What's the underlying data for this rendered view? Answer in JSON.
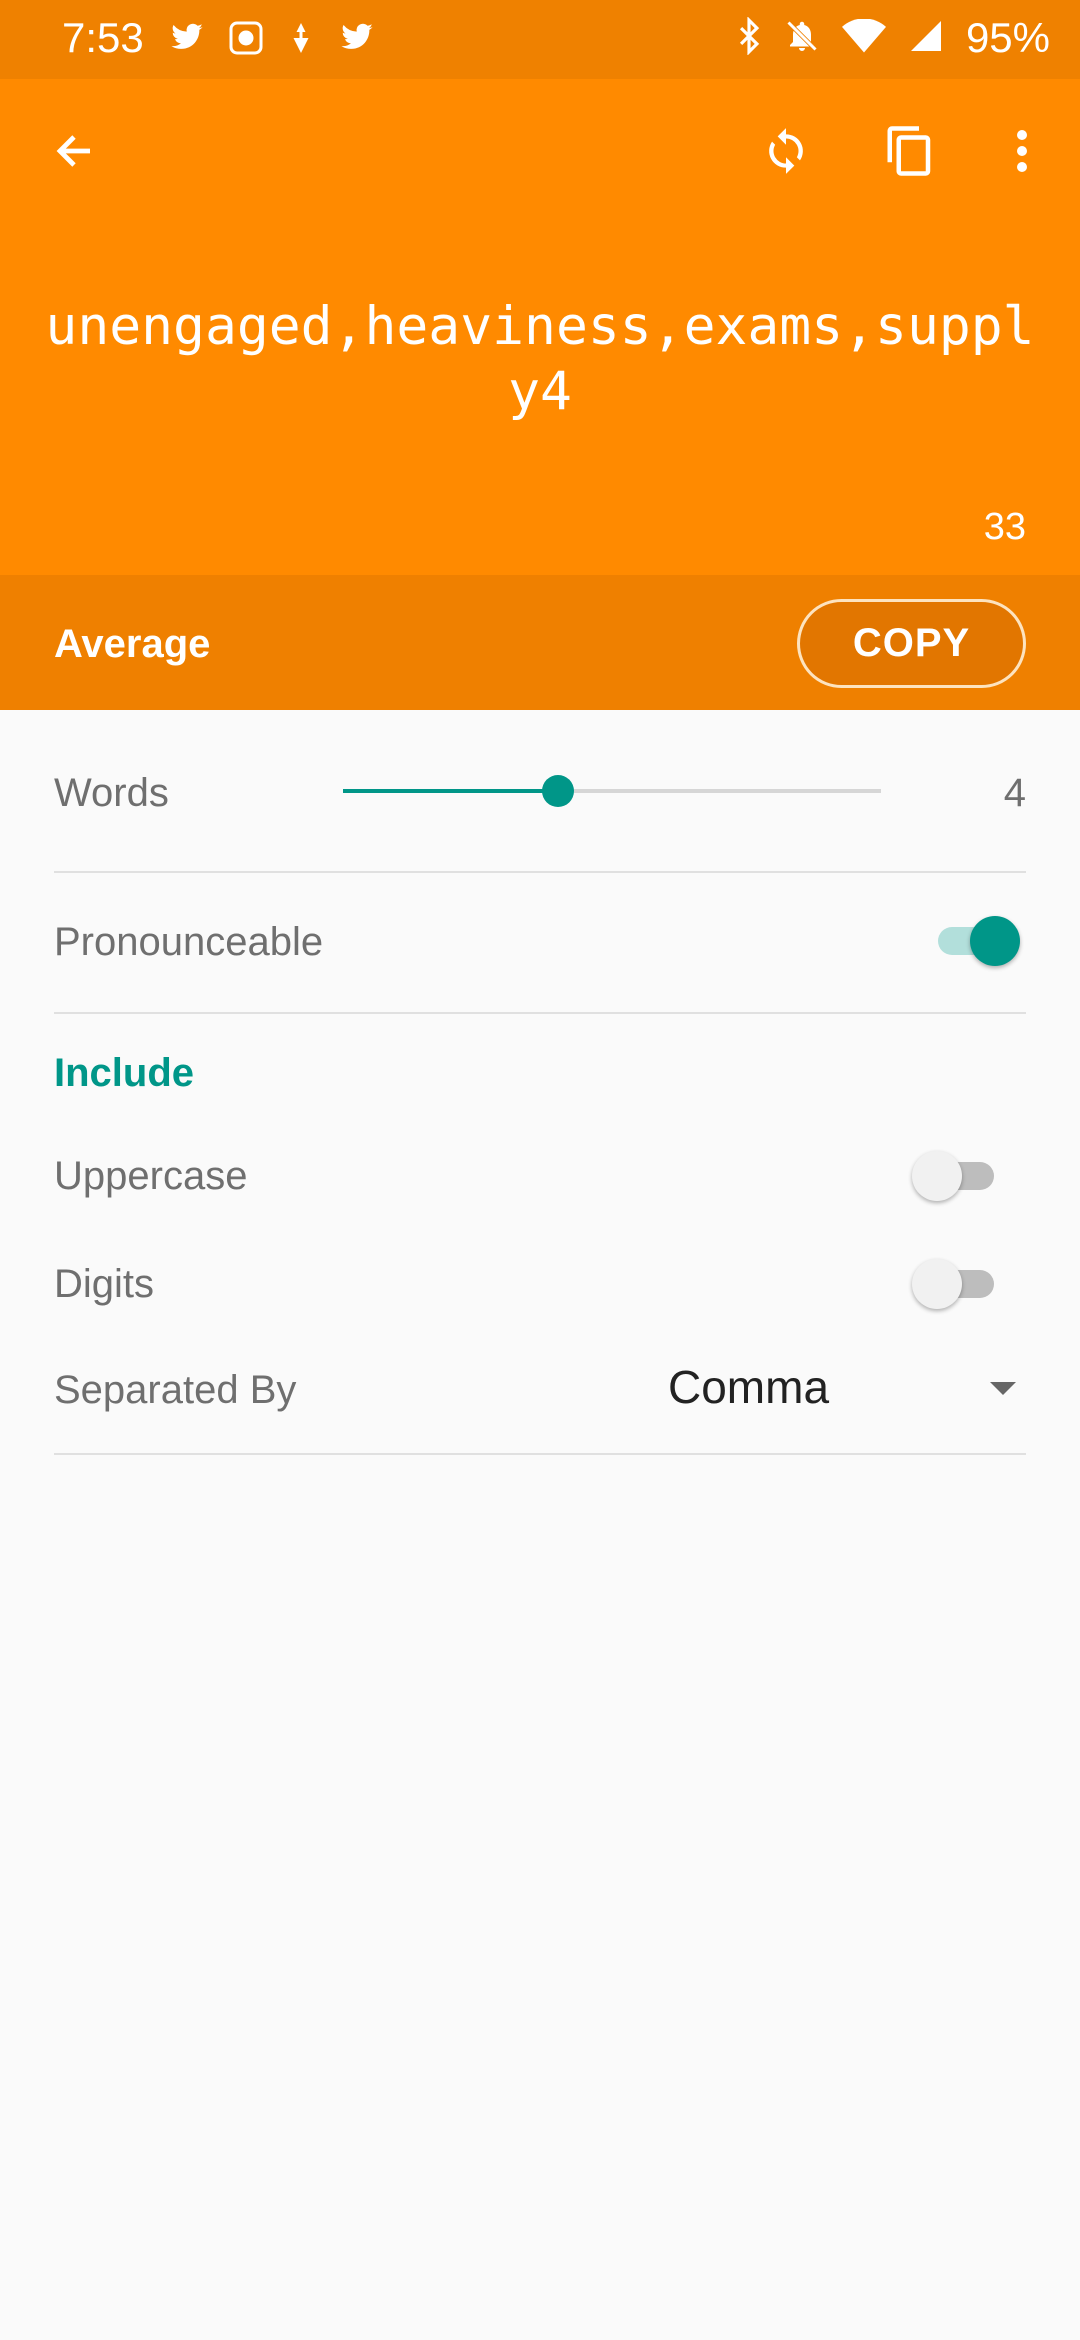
{
  "status_bar": {
    "time": "7:53",
    "battery": "95%",
    "left_icons": [
      "twitter-icon",
      "app-icon",
      "notification-icon",
      "twitter-icon"
    ],
    "right_icons": [
      "bluetooth-icon",
      "mute-icon",
      "wifi-icon",
      "signal-icon"
    ]
  },
  "toolbar": {
    "icons": [
      "back-arrow-icon",
      "refresh-icon",
      "copy-icon",
      "more-vert-icon"
    ]
  },
  "password": {
    "text": "unengaged,heaviness,exams,supply4",
    "length": "33"
  },
  "strength": {
    "label": "Average",
    "copy_label": "COPY"
  },
  "settings": {
    "words_label": "Words",
    "words_value": "4",
    "words_slider_fraction": 0.4,
    "pronounceable_label": "Pronounceable",
    "pronounceable_on": true,
    "include_title": "Include",
    "uppercase_label": "Uppercase",
    "uppercase_on": false,
    "digits_label": "Digits",
    "digits_on": false,
    "separated_label": "Separated By",
    "separated_value": "Comma"
  },
  "colors": {
    "primary": "#ff8a00",
    "primary_dark": "#ef8100",
    "accent": "#009688"
  }
}
